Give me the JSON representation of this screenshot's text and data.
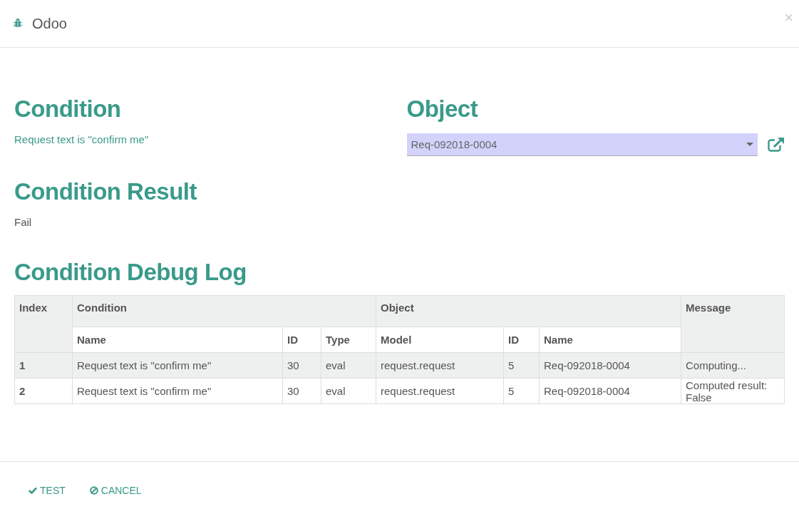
{
  "dialog": {
    "title": "Odoo",
    "close": "×"
  },
  "condition": {
    "heading": "Condition",
    "text": "Request text is \"confirm me\""
  },
  "object": {
    "heading": "Object",
    "value": "Req-092018-0004"
  },
  "result": {
    "heading": "Condition Result",
    "text": "Fail"
  },
  "debug_log": {
    "heading": "Condition Debug Log",
    "table": {
      "index_header": "Index",
      "groups": [
        {
          "label": "Condition",
          "columns": [
            "Name",
            "ID",
            "Type"
          ]
        },
        {
          "label": "Object",
          "columns": [
            "Model",
            "ID",
            "Name"
          ]
        }
      ],
      "message_header": "Message",
      "rows": [
        {
          "index": "1",
          "cells": [
            "Request text is \"confirm me\"",
            "30",
            "eval",
            "request.request",
            "5",
            "Req-092018-0004"
          ],
          "message": "Computing..."
        },
        {
          "index": "2",
          "cells": [
            "Request text is \"confirm me\"",
            "30",
            "eval",
            "request.request",
            "5",
            "Req-092018-0004"
          ],
          "message": "Computed result: False"
        }
      ]
    }
  },
  "buttons": [
    {
      "label": "TEST",
      "kind": "test"
    },
    {
      "label": "CANCEL",
      "kind": "cancel"
    }
  ]
}
